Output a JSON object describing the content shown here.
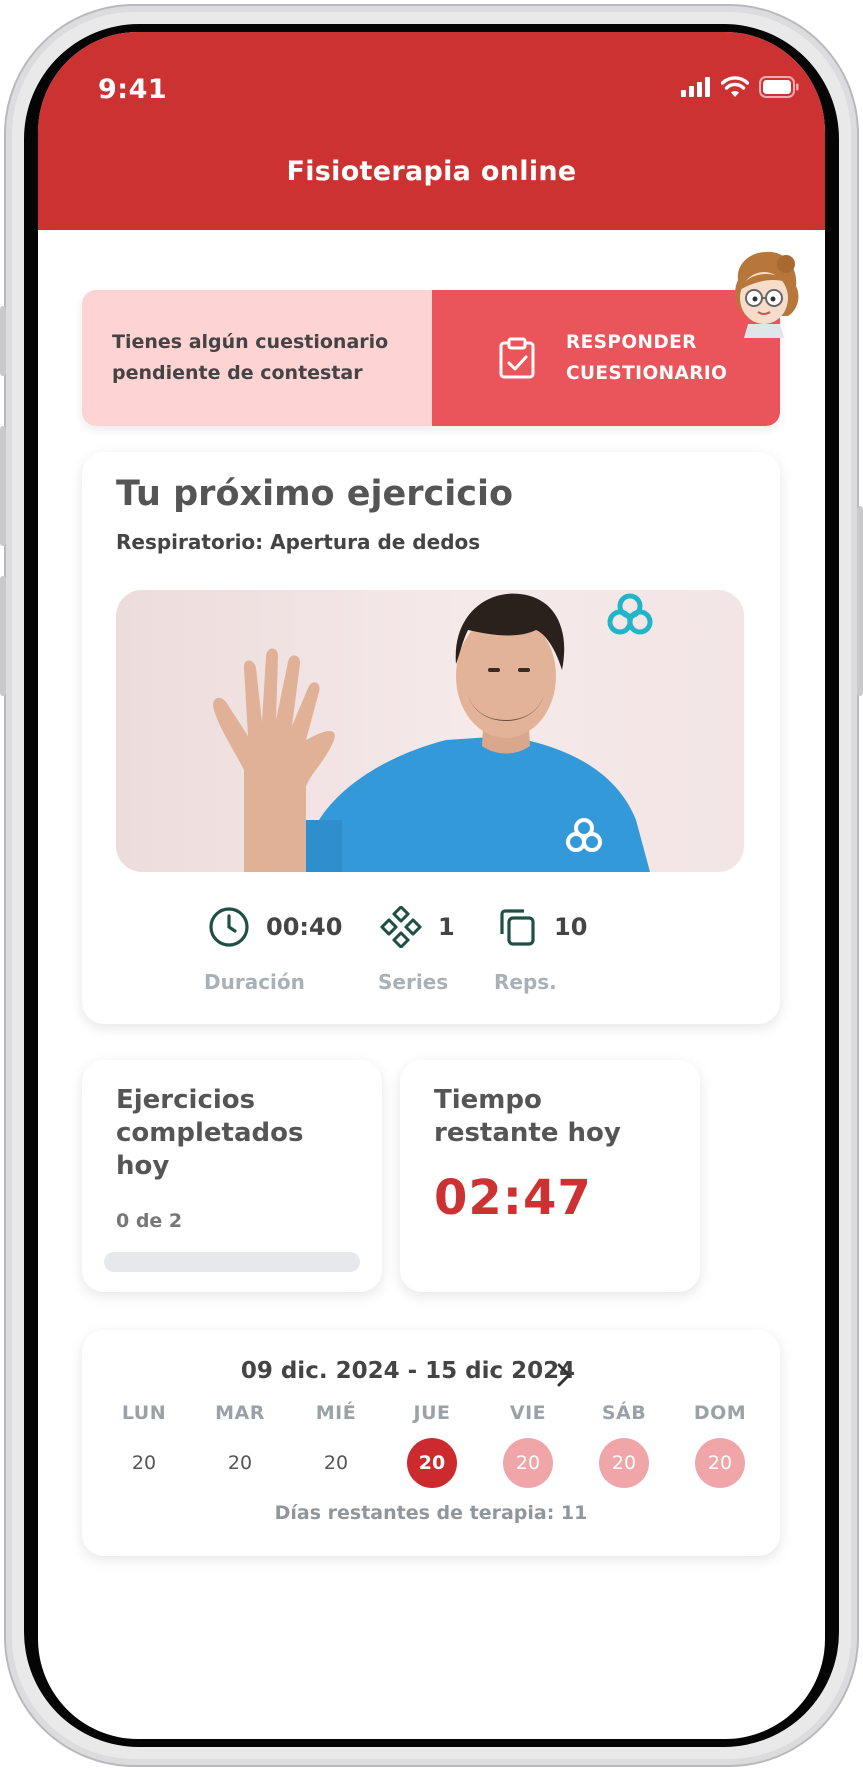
{
  "status_bar": {
    "time": "9:41"
  },
  "header": {
    "title": "Fisioterapia online"
  },
  "questionnaire": {
    "message": "Tienes algún cuestionario pendiente de contestar",
    "button_label": "RESPONDER CUESTIONARIO"
  },
  "next_exercise": {
    "heading": "Tu próximo ejercicio",
    "name": "Respiratorio: Apertura de dedos",
    "stats": [
      {
        "icon": "clock-icon",
        "value": "00:40",
        "label": "Duración"
      },
      {
        "icon": "series-icon",
        "value": "1",
        "label": "Series"
      },
      {
        "icon": "reps-icon",
        "value": "10",
        "label": "Reps."
      }
    ]
  },
  "completed": {
    "title": "Ejercicios completados hoy",
    "progress_text": "0 de 2",
    "progress_fraction": 0
  },
  "remaining": {
    "title": "Tiempo restante hoy",
    "time": "02:47"
  },
  "calendar": {
    "range": "09 dic. 2024 - 15 dic 2024",
    "days": [
      {
        "name": "LUN",
        "num": "20",
        "state": "past"
      },
      {
        "name": "MAR",
        "num": "20",
        "state": "past"
      },
      {
        "name": "MIÉ",
        "num": "20",
        "state": "past"
      },
      {
        "name": "JUE",
        "num": "20",
        "state": "today"
      },
      {
        "name": "VIE",
        "num": "20",
        "state": "future"
      },
      {
        "name": "SÁB",
        "num": "20",
        "state": "future"
      },
      {
        "name": "DOM",
        "num": "20",
        "state": "future"
      }
    ],
    "remaining_days": "Días restantes de terapia: 11"
  },
  "colors": {
    "brand_red": "#cc3232",
    "banner_light": "#fdd3d3",
    "banner_accent": "#e9555a",
    "stat_icon": "#1f4f45",
    "logo_teal": "#22b5c8"
  }
}
